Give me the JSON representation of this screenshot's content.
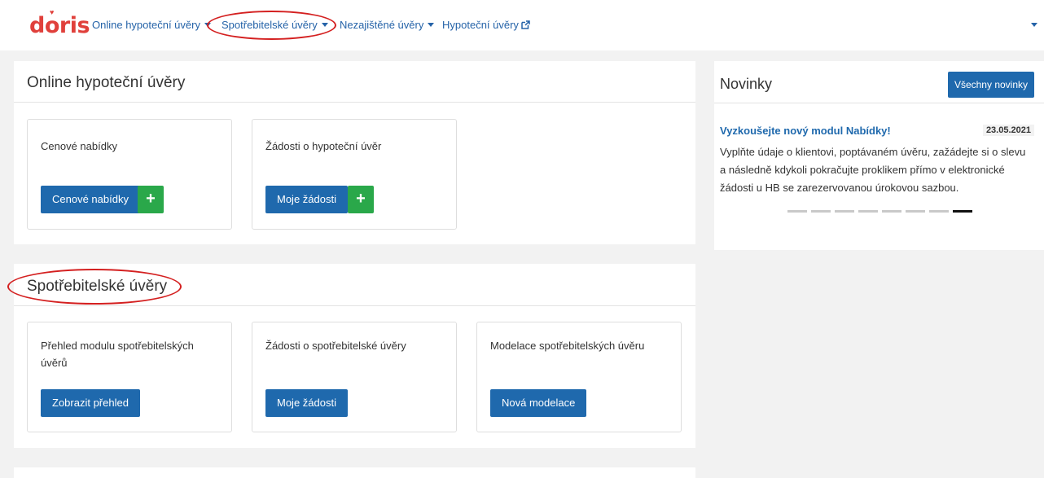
{
  "brand": {
    "logo": "doris",
    "logo_mark": "♥"
  },
  "nav": {
    "items": [
      {
        "label": "Online hypoteční úvěry"
      },
      {
        "label": "Spotřebitelské úvěry"
      },
      {
        "label": "Nezajištěné úvěry"
      },
      {
        "label": "Hypoteční úvěry"
      }
    ]
  },
  "sections": {
    "mortgage": {
      "title": "Online hypoteční úvěry",
      "cards": [
        {
          "title": "Cenové nabídky",
          "button": "Cenové nabídky",
          "plus": "+"
        },
        {
          "title": "Žádosti o hypoteční úvěr",
          "button": "Moje žádosti",
          "plus": "+"
        }
      ]
    },
    "consumer": {
      "title": "Spotřebitelské úvěry",
      "cards": [
        {
          "title": "Přehled modulu spotřebitelských úvěrů",
          "button": "Zobrazit přehled"
        },
        {
          "title": "Žádosti o spotřebitelské úvěry",
          "button": "Moje žádosti"
        },
        {
          "title": "Modelace spotřebitelských úvěru",
          "button": "Nová modelace"
        }
      ]
    }
  },
  "news": {
    "title": "Novinky",
    "all_button": "Všechny novinky",
    "headline": "Vyzkoušejte nový modul Nabídky!",
    "date": "23.05.2021",
    "text": "Vyplňte údaje o klientovi, poptávaném úvěru, zažádejte si o slevu a následně kdykoli pokračujte proklikem přímo v elektronické žádosti u HB se zarezervovanou úrokovou sazbou.",
    "slide_count": 8,
    "active_slide": 8
  },
  "colors": {
    "brand": "#e0403b",
    "primary": "#1f69ad",
    "success": "#2aa84a",
    "annotation": "#d42020"
  }
}
